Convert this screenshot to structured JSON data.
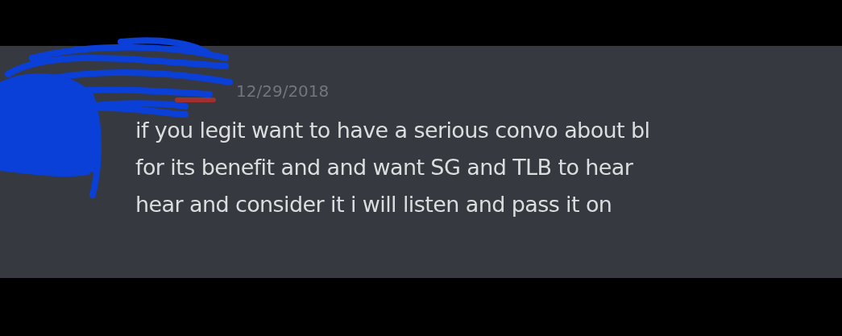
{
  "message": {
    "timestamp": "12/29/2018",
    "lines": [
      "if you legit want to have a serious convo about bl",
      "for its benefit and and want SG and TLB to hear",
      "hear and consider it i will listen and pass it on"
    ]
  }
}
